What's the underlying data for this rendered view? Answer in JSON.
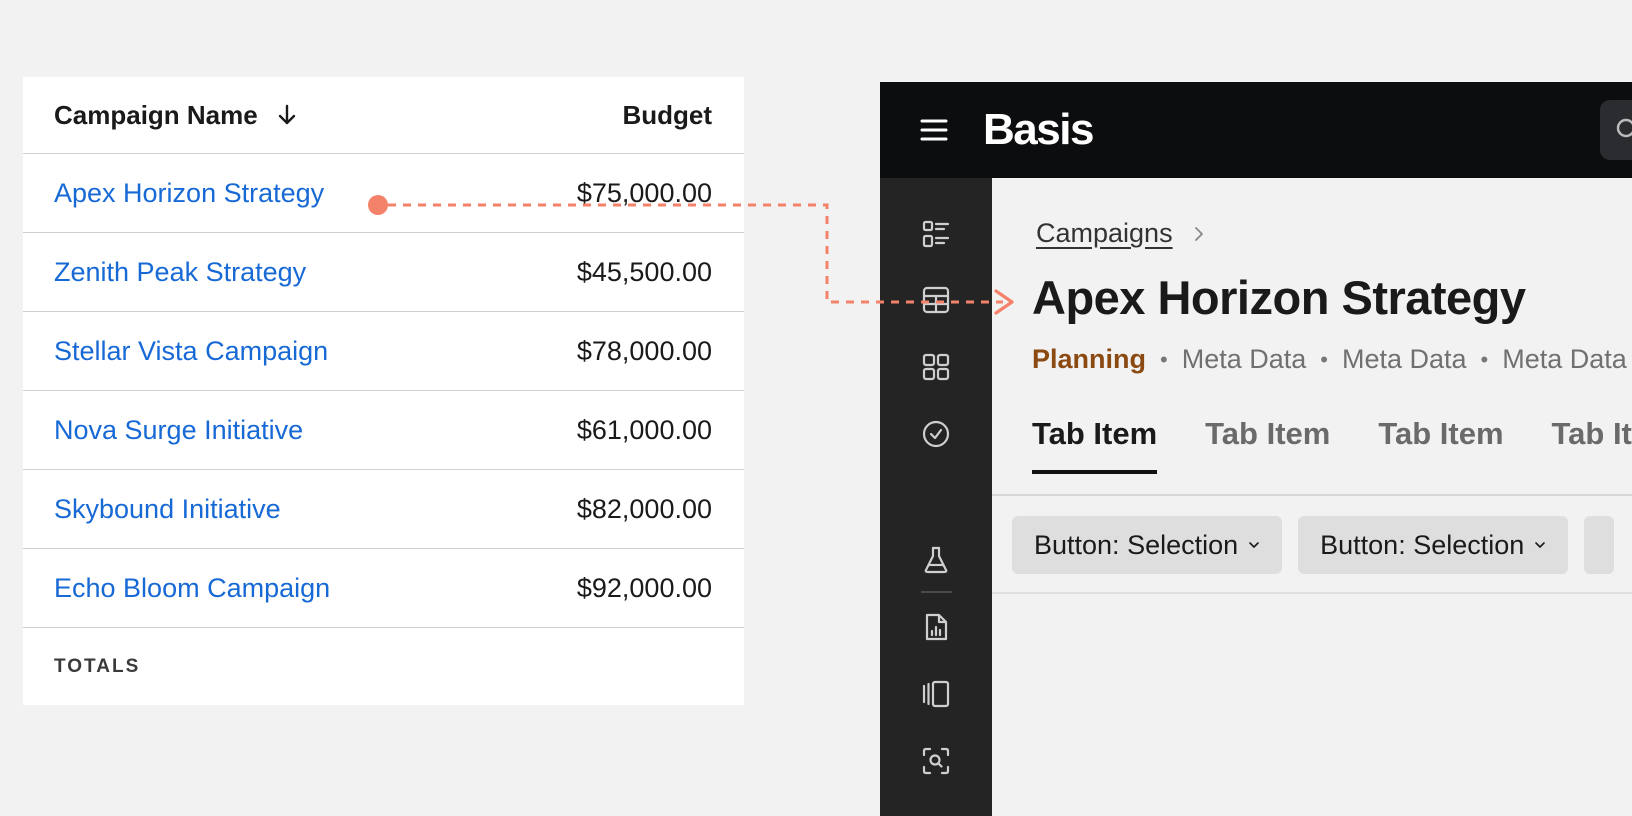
{
  "table": {
    "header": {
      "name": "Campaign Name",
      "budget": "Budget"
    },
    "rows": [
      {
        "name": "Apex Horizon Strategy",
        "budget": "$75,000.00"
      },
      {
        "name": "Zenith Peak Strategy",
        "budget": "$45,500.00"
      },
      {
        "name": "Stellar Vista Campaign",
        "budget": "$78,000.00"
      },
      {
        "name": "Nova Surge Initiative",
        "budget": "$61,000.00"
      },
      {
        "name": "Skybound Initiative",
        "budget": "$82,000.00"
      },
      {
        "name": "Echo Bloom Campaign",
        "budget": "$92,000.00"
      }
    ],
    "totals_label": "TOTALS",
    "sort_icon": "arrow-down-icon"
  },
  "connector": {
    "color": "#f4826a"
  },
  "app": {
    "brand": "Basis",
    "breadcrumb": {
      "parent": "Campaigns"
    },
    "title": "Apex Horizon Strategy",
    "status": "Planning",
    "meta": [
      "Meta Data",
      "Meta Data",
      "Meta Data"
    ],
    "tabs": [
      "Tab Item",
      "Tab Item",
      "Tab Item",
      "Tab Item"
    ],
    "buttons": [
      "Button: Selection",
      "Button: Selection"
    ],
    "nav_icons": [
      "list-icon",
      "table-icon",
      "grid-icon",
      "check-circle-icon",
      "flask-icon",
      "report-icon",
      "carousel-icon",
      "scan-search-icon"
    ]
  },
  "colors": {
    "link": "#1769d6",
    "status": "#8a4a12",
    "topbar": "#0b0d0f",
    "sidenav": "#242424"
  }
}
